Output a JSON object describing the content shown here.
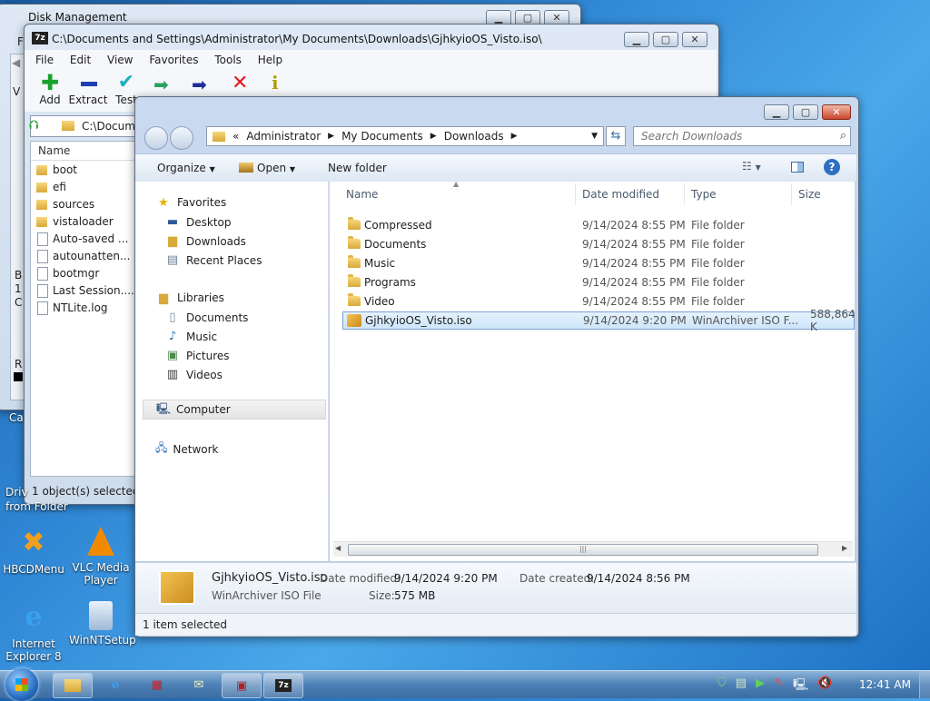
{
  "colors": {
    "accent": "#3399ff",
    "selection": "#cce8ff"
  },
  "disk_management": {
    "title": "Disk Management",
    "left_letters": [
      "F",
      "V"
    ],
    "side_text": [
      "B",
      "1",
      "C",
      "R"
    ]
  },
  "sevenzip": {
    "title": "C:\\Documents and Settings\\Administrator\\My Documents\\Downloads\\GjhkyioOS_Visto.iso\\",
    "menu": [
      "File",
      "Edit",
      "View",
      "Favorites",
      "Tools",
      "Help"
    ],
    "toolbar": [
      "Add",
      "Extract",
      "Test"
    ],
    "address": "C:\\Docume",
    "column_name": "Name",
    "files": [
      {
        "name": "boot",
        "icon": "folder"
      },
      {
        "name": "efi",
        "icon": "folder"
      },
      {
        "name": "sources",
        "icon": "folder"
      },
      {
        "name": "vistaloader",
        "icon": "folder"
      },
      {
        "name": "Auto-saved ...",
        "icon": "file"
      },
      {
        "name": "autounatten...",
        "icon": "file"
      },
      {
        "name": "bootmgr",
        "icon": "file"
      },
      {
        "name": "Last Session....",
        "icon": "file"
      },
      {
        "name": "NTLite.log",
        "icon": "file"
      }
    ],
    "status": "1 object(s) selected"
  },
  "explorer": {
    "breadcrumb": [
      "«",
      "Administrator",
      "My Documents",
      "Downloads"
    ],
    "search_placeholder": "Search Downloads",
    "toolbar": {
      "organize": "Organize",
      "open": "Open",
      "new_folder": "New folder"
    },
    "nav": {
      "favorites": "Favorites",
      "favorites_items": [
        "Desktop",
        "Downloads",
        "Recent Places"
      ],
      "libraries": "Libraries",
      "libraries_items": [
        "Documents",
        "Music",
        "Pictures",
        "Videos"
      ],
      "computer": "Computer",
      "network": "Network"
    },
    "columns": {
      "name": "Name",
      "date": "Date modified",
      "type": "Type",
      "size": "Size"
    },
    "rows": [
      {
        "name": "Compressed",
        "date": "9/14/2024 8:55 PM",
        "type": "File folder",
        "size": ""
      },
      {
        "name": "Documents",
        "date": "9/14/2024 8:55 PM",
        "type": "File folder",
        "size": ""
      },
      {
        "name": "Music",
        "date": "9/14/2024 8:55 PM",
        "type": "File folder",
        "size": ""
      },
      {
        "name": "Programs",
        "date": "9/14/2024 8:55 PM",
        "type": "File folder",
        "size": ""
      },
      {
        "name": "Video",
        "date": "9/14/2024 8:55 PM",
        "type": "File folder",
        "size": ""
      },
      {
        "name": "GjhkyioOS_Visto.iso",
        "date": "9/14/2024 9:20 PM",
        "type": "WinArchiver ISO F...",
        "size": "588,864 K"
      }
    ],
    "details": {
      "filename": "GjhkyioOS_Visto.iso",
      "filetype": "WinArchiver ISO File",
      "date_modified_label": "Date modified:",
      "date_modified": "9/14/2024 9:20 PM",
      "date_created_label": "Date created:",
      "date_created": "9/14/2024 8:56 PM",
      "size_label": "Size:",
      "size": "575 MB"
    },
    "status": "1 item selected"
  },
  "desktop": {
    "partial_labels": [
      "Ca",
      "Driv",
      "from Folder"
    ],
    "icons": [
      {
        "label": "HBCDMenu"
      },
      {
        "label": "VLC Media Player"
      },
      {
        "label": "Internet Explorer 8"
      },
      {
        "label": "WinNTSetup"
      }
    ]
  },
  "taskbar": {
    "clock": "12:41 AM"
  }
}
